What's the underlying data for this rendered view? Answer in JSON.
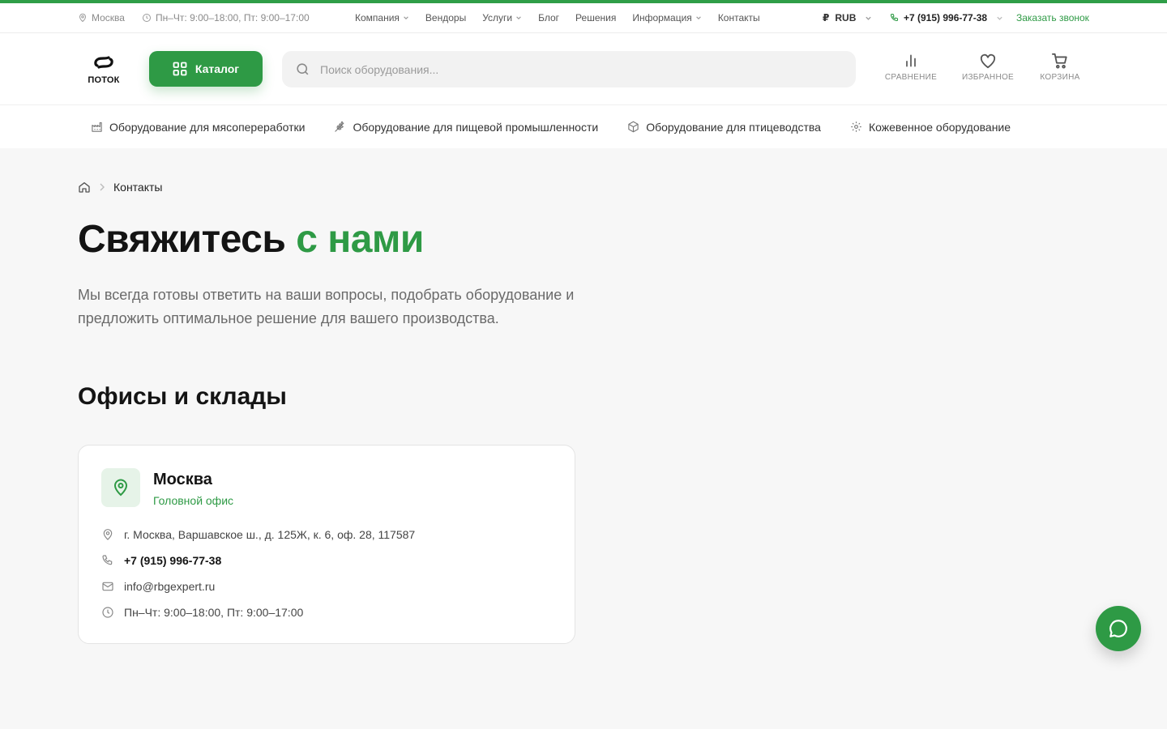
{
  "colors": {
    "accent": "#2e9a45",
    "accent_line": "#2f9e48",
    "accent_light": "#e6f3e8",
    "background": "#f7f7f7"
  },
  "topbar": {
    "city": "Москва",
    "hours": "Пн–Чт: 9:00–18:00, Пт: 9:00–17:00",
    "nav": [
      {
        "label": "Компания",
        "dropdown": true
      },
      {
        "label": "Вендоры",
        "dropdown": false
      },
      {
        "label": "Услуги",
        "dropdown": true
      },
      {
        "label": "Блог",
        "dropdown": false
      },
      {
        "label": "Решения",
        "dropdown": false
      },
      {
        "label": "Информация",
        "dropdown": true
      },
      {
        "label": "Контакты",
        "dropdown": false
      }
    ],
    "currency": "RUB",
    "currency_symbol": "₽",
    "phone": "+7 (915) 996-77-38",
    "callback": "Заказать звонок"
  },
  "header": {
    "logo_text": "ПОТОК",
    "catalog_label": "Каталог",
    "search_placeholder": "Поиск оборудования...",
    "compare_label": "СРАВНЕНИЕ",
    "favorites_label": "ИЗБРАННОЕ",
    "cart_label": "КОРЗИНА"
  },
  "categories": [
    {
      "label": "Оборудование для мясопереработки",
      "icon": "factory-icon"
    },
    {
      "label": "Оборудование для пищевой промышленности",
      "icon": "wheat-icon"
    },
    {
      "label": "Оборудование для птицеводства",
      "icon": "box-icon"
    },
    {
      "label": "Кожевенное оборудование",
      "icon": "gear-icon"
    }
  ],
  "breadcrumb": {
    "current": "Контакты"
  },
  "page": {
    "title_main": "Свяжитесь",
    "title_accent": "с нами",
    "lead": "Мы всегда готовы ответить на ваши вопросы, подобрать оборудование и предложить оптимальное решение для вашего производства.",
    "offices_title": "Офисы и склады"
  },
  "office": {
    "city": "Москва",
    "type": "Головной офис",
    "address": "г. Москва, Варшавское ш., д. 125Ж, к. 6, оф. 28, 117587",
    "phone": "+7 (915) 996-77-38",
    "email": "info@rbgexpert.ru",
    "hours": "Пн–Чт: 9:00–18:00, Пт: 9:00–17:00"
  }
}
